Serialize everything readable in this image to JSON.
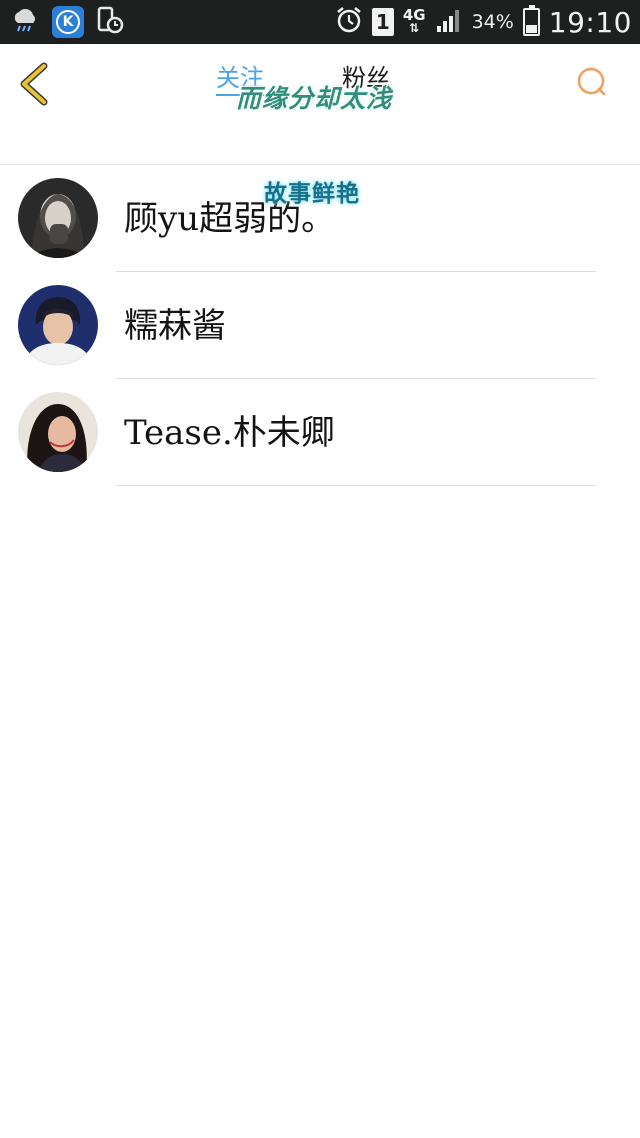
{
  "status_bar": {
    "icons": [
      "weather-rain-icon",
      "k-app-icon",
      "screen-clock-icon",
      "alarm-icon",
      "sim-1-icon",
      "network-4g-icon",
      "signal-icon",
      "battery-icon"
    ],
    "sim_label": "1",
    "network_label": "4G",
    "battery_percent": "34%",
    "battery_level": 0.34,
    "time": "19:10"
  },
  "header": {
    "back_icon": "chevron-left-icon",
    "tab_follow_label": "关注",
    "tab_fans_label": "粉丝",
    "search_icon": "search-icon",
    "accent_back": "#e8c230",
    "accent_search": "#f0a05a",
    "accent_tab": "#4aa3e6"
  },
  "overlays": {
    "line1": "而缘分却太浅",
    "line2": "故事鲜艳"
  },
  "users": [
    {
      "name": "顾yu超弱的。"
    },
    {
      "name": "糯菻酱"
    },
    {
      "name": "Tease.朴未卿"
    }
  ]
}
